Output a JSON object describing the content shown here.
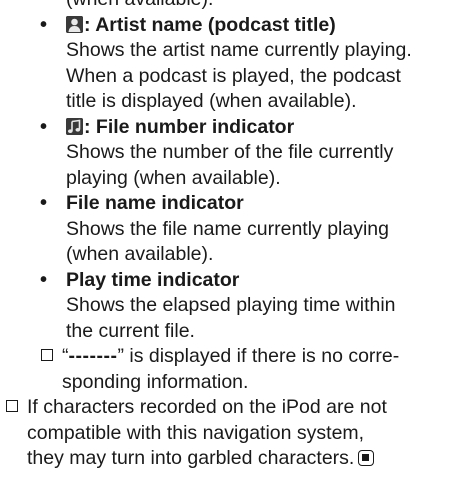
{
  "top_fragment": "(when available).",
  "items": [
    {
      "icon": "artist-person-icon",
      "title": ": Artist name (podcast title)",
      "desc": [
        "Shows the artist name currently playing.",
        "When a podcast is played, the podcast",
        "title is displayed (when available)."
      ]
    },
    {
      "icon": "music-note-icon",
      "title": ": File number indicator",
      "desc": [
        "Shows the number of the file currently",
        "playing (when available)."
      ]
    },
    {
      "title": "File name indicator",
      "desc": [
        "Shows the file name currently playing",
        "(when available)."
      ]
    },
    {
      "title": "Play time indicator",
      "desc": [
        "Shows the elapsed playing time within",
        "the current file."
      ]
    }
  ],
  "note_inner": {
    "open_quote": "“",
    "dashes": "-------",
    "line1_rest": "” is displayed if there is no corre-",
    "line2": "sponding information."
  },
  "note_outer": {
    "lines": [
      "If characters recorded on the iPod are not",
      "compatible with this navigation system,",
      "they may turn into garbled characters."
    ],
    "end_icon": "end-of-section-icon"
  },
  "bullet_char": "•"
}
